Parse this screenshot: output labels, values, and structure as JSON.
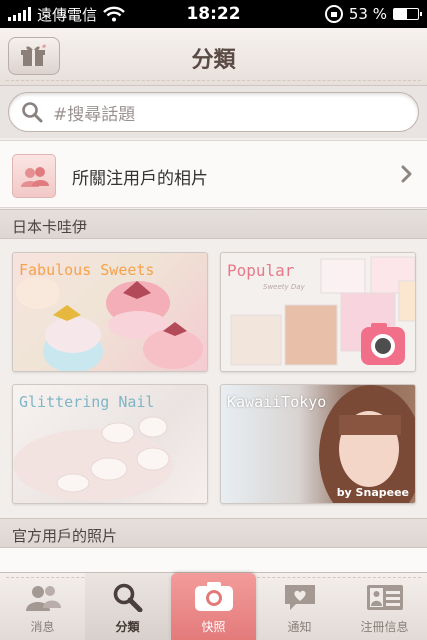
{
  "status": {
    "carrier": "遠傳電信",
    "time": "18:22",
    "battery": "53 %",
    "battery_level": 0.53
  },
  "nav": {
    "title": "分類",
    "left_icon": "gift-icon"
  },
  "search": {
    "placeholder": "#搜尋話題"
  },
  "follow": {
    "label": "所關注用戶的相片"
  },
  "sections": {
    "japan_kawaii": "日本卡哇伊",
    "official_users": "官方用戶的照片"
  },
  "tiles": [
    {
      "label": "Fabulous Sweets",
      "color": "#f6a24a"
    },
    {
      "label": "Popular",
      "subtitle": "Sweety Day",
      "color": "#e67a8a"
    },
    {
      "label": "Glittering Nail",
      "color": "#7fb6c6"
    },
    {
      "label": "KawaiiTokyo",
      "watermark": "by Snapeee",
      "color": "#ffffff"
    }
  ],
  "tabs": [
    {
      "label": "消息",
      "icon": "people-icon"
    },
    {
      "label": "分類",
      "icon": "search-icon"
    },
    {
      "label": "快照",
      "icon": "camera-icon"
    },
    {
      "label": "通知",
      "icon": "heart-bubble-icon"
    },
    {
      "label": "注冊信息",
      "icon": "profile-card-icon"
    }
  ],
  "colors": {
    "accent": "#e37a7a",
    "background": "#f1eeec"
  }
}
